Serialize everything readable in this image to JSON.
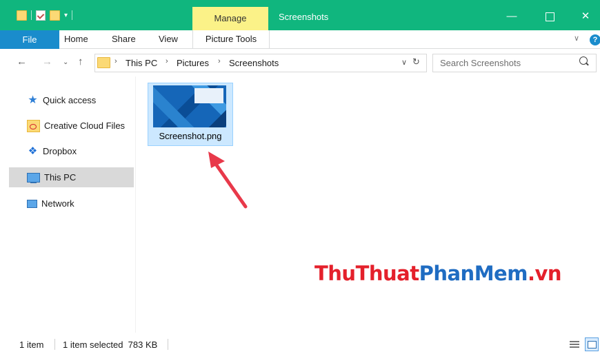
{
  "window": {
    "title": "Screenshots",
    "contextual_tab": "Manage",
    "controls": {
      "minimize": "—",
      "close": "✕"
    }
  },
  "ribbon": {
    "tabs": [
      "File",
      "Home",
      "Share",
      "View"
    ],
    "contextual_group": "Picture Tools"
  },
  "address": {
    "crumbs": [
      "This PC",
      "Pictures",
      "Screenshots"
    ],
    "separator": "›"
  },
  "search": {
    "placeholder": "Search Screenshots"
  },
  "sidebar": {
    "items": [
      {
        "label": "Quick access",
        "icon": "star-icon"
      },
      {
        "label": "Creative Cloud Files",
        "icon": "creative-cloud-folder-icon"
      },
      {
        "label": "Dropbox",
        "icon": "dropbox-icon"
      },
      {
        "label": "This PC",
        "icon": "computer-icon",
        "selected": true
      },
      {
        "label": "Network",
        "icon": "network-icon"
      }
    ]
  },
  "files": [
    {
      "name": "Screenshot.png",
      "selected": true
    }
  ],
  "watermark": {
    "part1": "ThuThuat",
    "part2": "PhanMem",
    "part3": ".vn"
  },
  "status": {
    "count": "1 item",
    "selection": "1 item selected  783 KB"
  },
  "colors": {
    "titlebar": "#10b67e",
    "manage_tab": "#fbf288",
    "file_tab": "#1a8ccc",
    "selection": "#cce8ff",
    "arrow": "#e8394a"
  }
}
